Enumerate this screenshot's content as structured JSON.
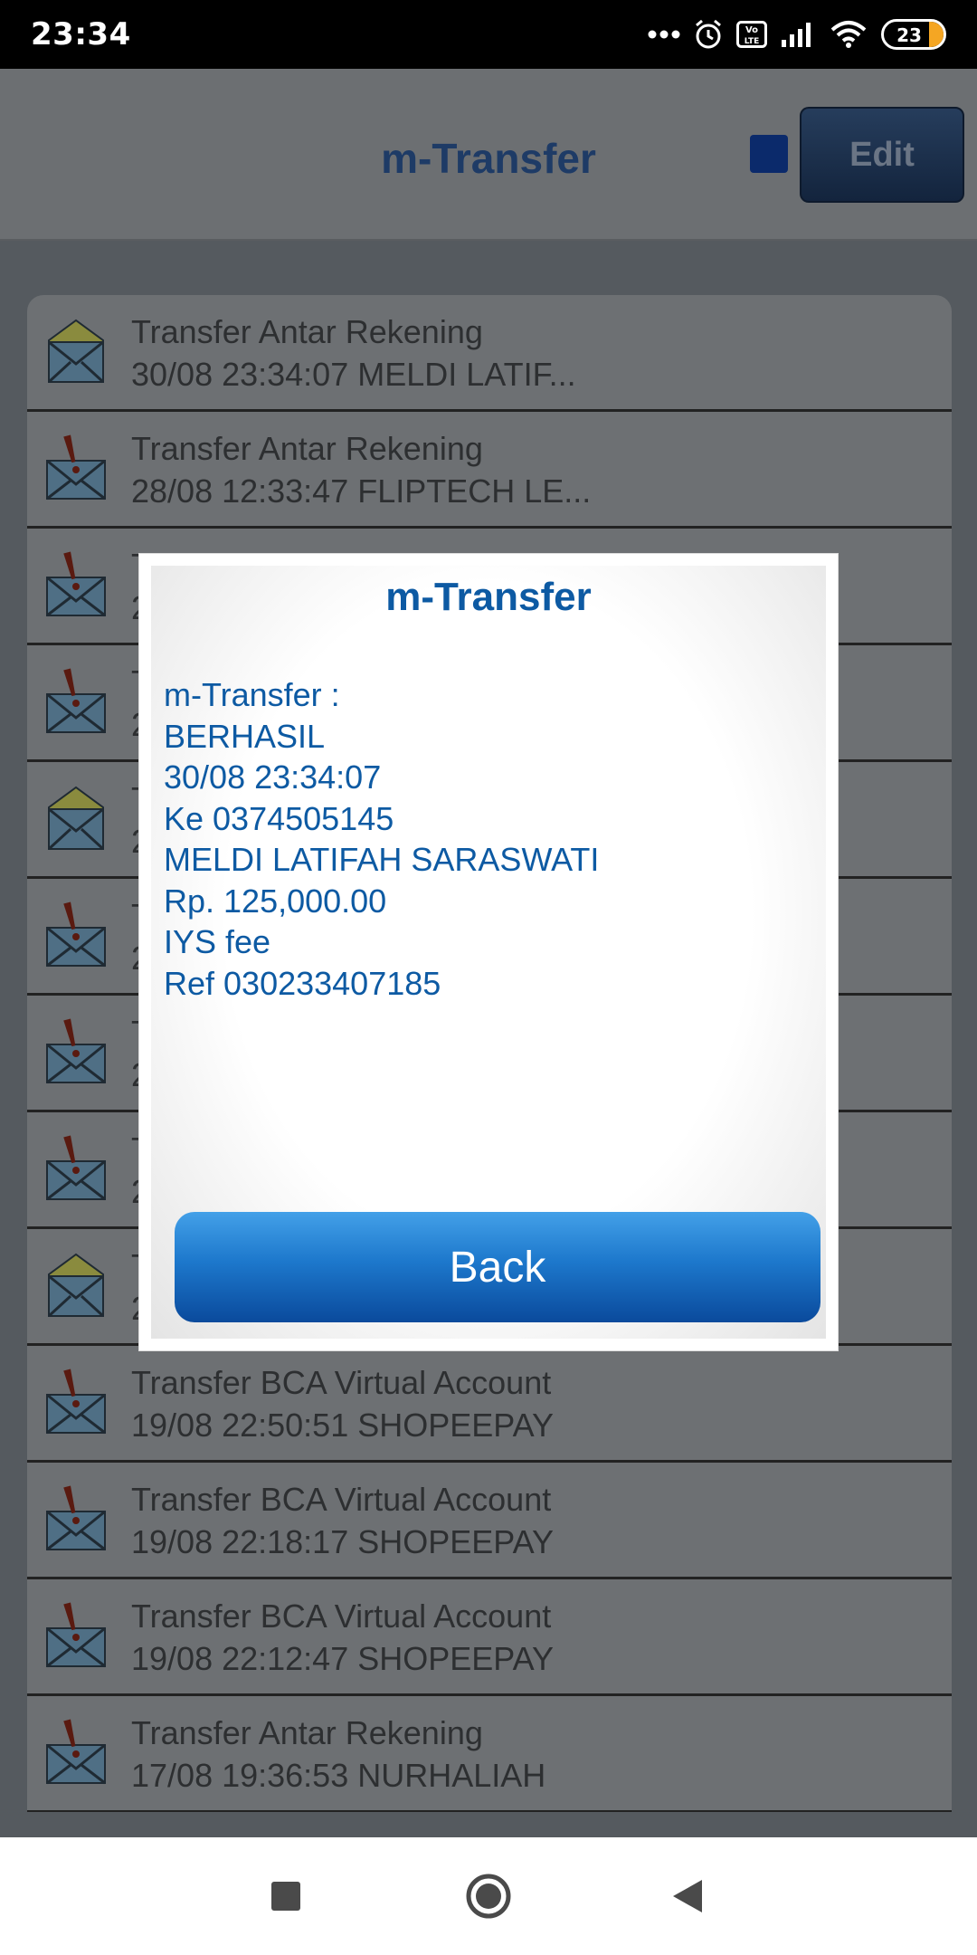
{
  "status_bar": {
    "time": "23:34",
    "battery": "23"
  },
  "header": {
    "title": "m-Transfer",
    "edit_label": "Edit"
  },
  "list": {
    "items": [
      {
        "icon": "open-envelope-icon",
        "title": "Transfer Antar Rekening",
        "subtitle": "30/08 23:34:07 MELDI LATIF..."
      },
      {
        "icon": "alert-envelope-icon",
        "title": "Transfer Antar Rekening",
        "subtitle": "28/08 12:33:47 FLIPTECH LE..."
      },
      {
        "icon": "alert-envelope-icon",
        "title": "Transfer Antar Rekening",
        "subtitle": "2"
      },
      {
        "icon": "alert-envelope-icon",
        "title": "T",
        "subtitle": "2"
      },
      {
        "icon": "open-envelope-icon",
        "title": "T",
        "subtitle": "2"
      },
      {
        "icon": "alert-envelope-icon",
        "title": "T",
        "subtitle": "2"
      },
      {
        "icon": "alert-envelope-icon",
        "title": "T",
        "subtitle": "2"
      },
      {
        "icon": "alert-envelope-icon",
        "title": "T",
        "subtitle": "2"
      },
      {
        "icon": "open-envelope-icon",
        "title": "T",
        "subtitle": "2"
      },
      {
        "icon": "alert-envelope-icon",
        "title": "Transfer BCA Virtual Account",
        "subtitle": "19/08 22:50:51 SHOPEEPAY"
      },
      {
        "icon": "alert-envelope-icon",
        "title": "Transfer BCA Virtual Account",
        "subtitle": "19/08 22:18:17 SHOPEEPAY"
      },
      {
        "icon": "alert-envelope-icon",
        "title": "Transfer BCA Virtual Account",
        "subtitle": "19/08 22:12:47 SHOPEEPAY"
      },
      {
        "icon": "alert-envelope-icon",
        "title": "Transfer Antar Rekening",
        "subtitle": "17/08 19:36:53 NURHALIAH"
      }
    ]
  },
  "dialog": {
    "title": "m-Transfer",
    "lines": [
      "m-Transfer :",
      "BERHASIL",
      "30/08 23:34:07",
      "Ke 0374505145",
      "MELDI LATIFAH SARASWATI",
      "Rp. 125,000.00",
      "IYS fee",
      "Ref 030233407185"
    ],
    "back_label": "Back"
  },
  "nav": {
    "buttons": [
      "recents-icon",
      "home-icon",
      "back-icon"
    ]
  },
  "colors": {
    "accent": "#0d5aa3",
    "button_top": "#43a0e8",
    "button_bottom": "#0a4a9c"
  }
}
